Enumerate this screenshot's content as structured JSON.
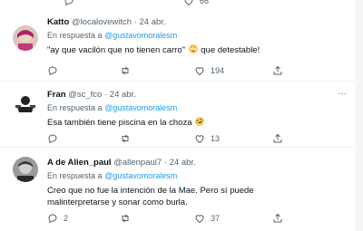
{
  "tweets": [
    {
      "name": "Katto",
      "handle": "@localovewitch",
      "time": "· 24 abr.",
      "reply_prefix": "En respuesta a",
      "reply_to": "@gustavomoralesm",
      "text_before": "\"ay que vacilón que no tienen carro\"",
      "text_after": "que detestable!",
      "emoji": "rolling-eyes",
      "replies": "",
      "retweets": "",
      "likes": "194",
      "top_likes": "66"
    },
    {
      "name": "Fran",
      "handle": "@sc_fco",
      "time": "· 24 abr.",
      "reply_prefix": "En respuesta a",
      "reply_to": "@gustavomoralesm",
      "text_before": "Esa también tiene piscina en la choza",
      "emoji": "rofl",
      "replies": "",
      "retweets": "",
      "likes": "13"
    },
    {
      "name": "A de Alien_paul",
      "handle": "@allenpaul7",
      "time": "· 24 abr.",
      "reply_prefix": "En respuesta a",
      "reply_to": "@gustavomoralesm",
      "text": "Creo que no fue la intención de la Mae. Pero sí puede malinterpretarse y sonar como burla.",
      "replies": "2",
      "retweets": "",
      "likes": "37"
    }
  ],
  "colors": {
    "link": "#1d9bf0",
    "muted": "#536471",
    "text": "#0f1419",
    "border": "#eff3f4"
  }
}
